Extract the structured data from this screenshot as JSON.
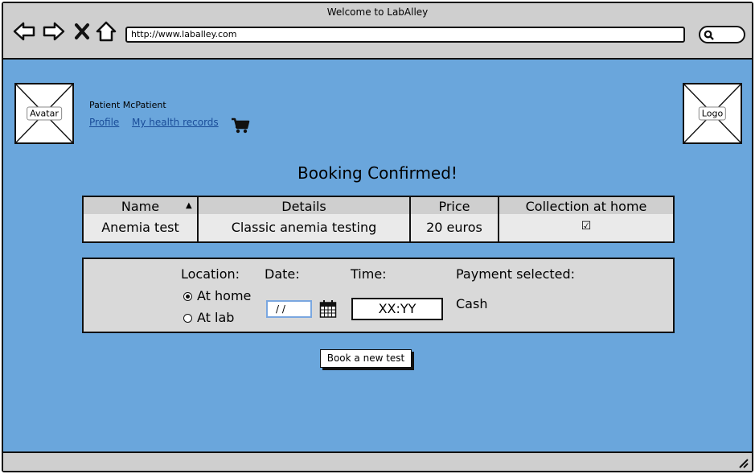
{
  "browser": {
    "title": "Welcome to LabAlley",
    "url": "http://www.laballey.com"
  },
  "header": {
    "avatar_label": "Avatar",
    "logo_label": "Logo",
    "patient_name": "Patient McPatient",
    "links": [
      "Profile",
      "My health records"
    ],
    "cart_icon": "cart-icon"
  },
  "main": {
    "heading": "Booking Confirmed!",
    "table": {
      "columns": [
        "Name",
        "Details",
        "Price",
        "Collection at home"
      ],
      "sort_indicator": "▲",
      "rows": [
        {
          "name": "Anemia test",
          "details": "Classic anemia testing",
          "price": "20 euros",
          "collection_at_home": "☑"
        }
      ]
    },
    "booking": {
      "location_label": "Location:",
      "location_options": [
        "At home",
        "At lab"
      ],
      "location_selected": "At home",
      "date_label": "Date:",
      "date_value": "/ /",
      "time_label": "Time:",
      "time_value": "XX:YY",
      "payment_label": "Payment selected:",
      "payment_value": "Cash"
    },
    "new_test_button": "Book a new test"
  },
  "colors": {
    "page_bg": "#6aa6dc",
    "chrome": "#cfcfcf",
    "link": "#1a4d99"
  }
}
